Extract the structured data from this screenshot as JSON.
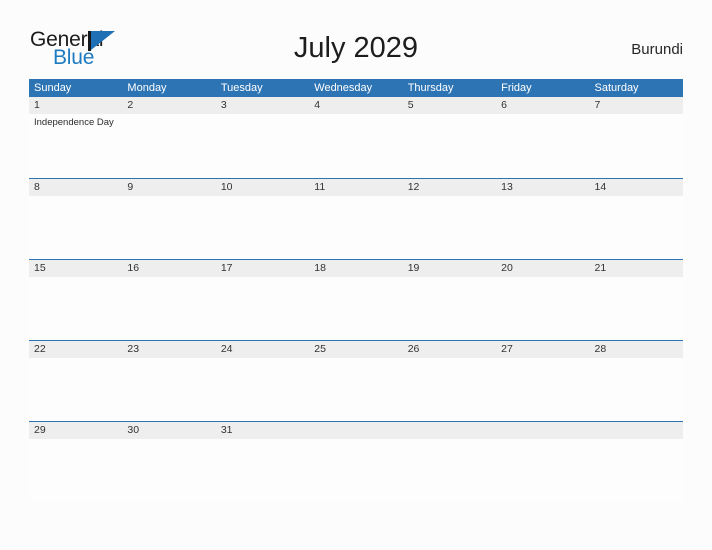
{
  "brand": {
    "name_part1": "General",
    "name_part2": "Blue",
    "color_dark": "#1b1b1b",
    "color_blue": "#1f7bc1"
  },
  "header": {
    "title": "July 2029",
    "country": "Burundi"
  },
  "theme": {
    "header_blue": "#2d74b5",
    "date_band_gray": "#eeeeee",
    "page_background": "#fcfcfd"
  },
  "calendar": {
    "weekdays": [
      "Sunday",
      "Monday",
      "Tuesday",
      "Wednesday",
      "Thursday",
      "Friday",
      "Saturday"
    ],
    "weeks": [
      {
        "days": [
          {
            "date": "1",
            "events": [
              "Independence Day"
            ]
          },
          {
            "date": "2",
            "events": []
          },
          {
            "date": "3",
            "events": []
          },
          {
            "date": "4",
            "events": []
          },
          {
            "date": "5",
            "events": []
          },
          {
            "date": "6",
            "events": []
          },
          {
            "date": "7",
            "events": []
          }
        ]
      },
      {
        "days": [
          {
            "date": "8",
            "events": []
          },
          {
            "date": "9",
            "events": []
          },
          {
            "date": "10",
            "events": []
          },
          {
            "date": "11",
            "events": []
          },
          {
            "date": "12",
            "events": []
          },
          {
            "date": "13",
            "events": []
          },
          {
            "date": "14",
            "events": []
          }
        ]
      },
      {
        "days": [
          {
            "date": "15",
            "events": []
          },
          {
            "date": "16",
            "events": []
          },
          {
            "date": "17",
            "events": []
          },
          {
            "date": "18",
            "events": []
          },
          {
            "date": "19",
            "events": []
          },
          {
            "date": "20",
            "events": []
          },
          {
            "date": "21",
            "events": []
          }
        ]
      },
      {
        "days": [
          {
            "date": "22",
            "events": []
          },
          {
            "date": "23",
            "events": []
          },
          {
            "date": "24",
            "events": []
          },
          {
            "date": "25",
            "events": []
          },
          {
            "date": "26",
            "events": []
          },
          {
            "date": "27",
            "events": []
          },
          {
            "date": "28",
            "events": []
          }
        ]
      },
      {
        "days": [
          {
            "date": "29",
            "events": []
          },
          {
            "date": "30",
            "events": []
          },
          {
            "date": "31",
            "events": []
          },
          {
            "date": "",
            "events": []
          },
          {
            "date": "",
            "events": []
          },
          {
            "date": "",
            "events": []
          },
          {
            "date": "",
            "events": []
          }
        ]
      }
    ]
  }
}
